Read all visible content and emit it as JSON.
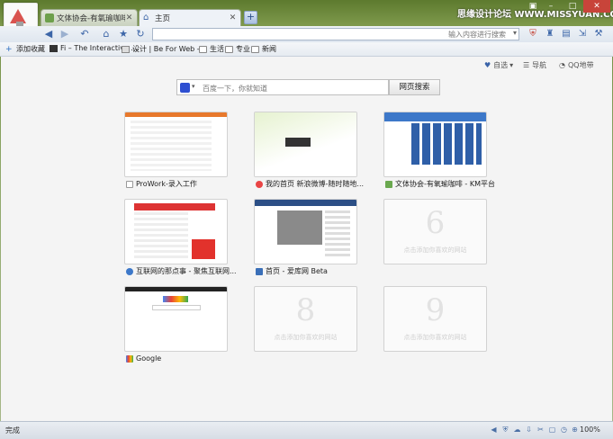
{
  "window": {
    "tabs": [
      {
        "label": "文体协会-有氧瑜咖啡 - K...",
        "active": false
      },
      {
        "label": "主页",
        "active": true
      }
    ],
    "new_tab": "+",
    "watermark": "思缘设计论坛 WWW.MISSYUAN.COM"
  },
  "toolbar": {
    "back": "◀",
    "forward": "▶",
    "undo": "↶",
    "home": "⌂",
    "favorite": "★",
    "refresh": "↻",
    "address_placeholder": "输入内容进行搜索",
    "right_icons": [
      "shield-icon",
      "broom-icon",
      "tools-icon",
      "export-icon",
      "wrench-icon",
      "weibo-icon"
    ]
  },
  "bookmarks": [
    {
      "label": "添加收藏",
      "icon": "plus-icon"
    },
    {
      "label": "Fi – The Interactive ...",
      "icon": "fi-icon"
    },
    {
      "label": "设计 | Be For Web -...",
      "icon": "page-icon"
    },
    {
      "label": "生活",
      "icon": "folder-icon"
    },
    {
      "label": "专业",
      "icon": "folder-icon"
    },
    {
      "label": "新闻",
      "icon": "folder-icon"
    }
  ],
  "page": {
    "top_links": [
      {
        "label": "自选",
        "icon": "heart-icon"
      },
      {
        "label": "导航",
        "icon": "menu-icon"
      },
      {
        "label": "QQ地带",
        "icon": "qq-icon"
      }
    ],
    "search": {
      "placeholder": "百度一下，你就知道",
      "button": "网页搜索"
    },
    "tiles": [
      {
        "label": "ProWork-录入工作",
        "empty": false,
        "color": "#e8792c"
      },
      {
        "label": "我的首页 新浪微博-随时随地...",
        "empty": false,
        "color": "#e94545"
      },
      {
        "label": "文体协会-有氧瑜咖啡 - KM平台",
        "empty": false,
        "color": "#3d78c9"
      },
      {
        "label": "互联网的那点事 - 聚焦互联网...",
        "empty": false,
        "color": "#e2322c"
      },
      {
        "label": "首页 - 爱库网 Beta",
        "empty": false,
        "color": "#3a6fb8"
      },
      {
        "label": "",
        "empty": true,
        "number": "6",
        "hint": "点击添加你喜欢的网站"
      },
      {
        "label": "Google",
        "empty": false,
        "color": "#4285f4"
      },
      {
        "label": "",
        "empty": true,
        "number": "8",
        "hint": "点击添加你喜欢的网站"
      },
      {
        "label": "",
        "empty": true,
        "number": "9",
        "hint": "点击添加你喜欢的网站"
      }
    ]
  },
  "status": {
    "text": "完成",
    "zoom": "100%"
  }
}
